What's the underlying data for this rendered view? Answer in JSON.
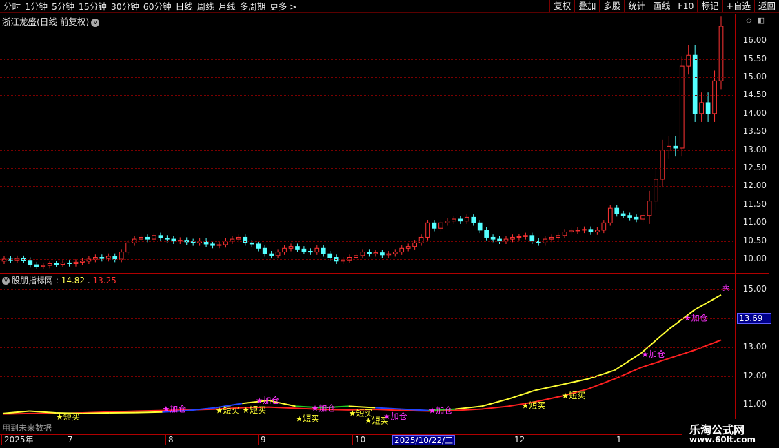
{
  "toolbar": {
    "periods": [
      "分时",
      "1分钟",
      "5分钟",
      "15分钟",
      "30分钟",
      "60分钟",
      "日线",
      "周线",
      "月线",
      "多周期",
      "更多 >"
    ],
    "active_period": "日线",
    "buttons": [
      "复权",
      "叠加",
      "多股",
      "统计",
      "画线",
      "F10",
      "标记",
      "+自选",
      "返回"
    ]
  },
  "price_chart": {
    "title": "浙江龙盛(日线 前复权)",
    "axis_ticks": [
      "16.00",
      "15.50",
      "15.00",
      "14.50",
      "14.00",
      "13.50",
      "13.00",
      "12.50",
      "12.00",
      "11.50",
      "11.00",
      "10.50",
      "10.00"
    ]
  },
  "indicator": {
    "name": "股朋指标网",
    "value1": "14.82",
    "value2": "13.25",
    "cursor_value": "13.69",
    "axis_ticks": [
      "15.00",
      "14.00",
      "13.00",
      "12.00",
      "11.00"
    ],
    "signals": [
      "短买",
      "加仓",
      "卖"
    ],
    "future_note": "用到未来数据"
  },
  "date_axis": {
    "labels": [
      "2025年",
      "7",
      "8",
      "9",
      "10",
      "12",
      "1"
    ],
    "cursor_date": "2025/10/22/三"
  },
  "watermark": {
    "site_name": "乐淘公式网",
    "url": "www.60lt.com"
  },
  "colors": {
    "up": "#ff3333",
    "down": "#54ffff",
    "line_yellow": "#ffff33",
    "line_red": "#ff2020",
    "segment_blue": "#2244ff",
    "segment_green": "#22cc22",
    "signal_buy": "#ffff33",
    "signal_add": "#ff33ff"
  },
  "chart_data": [
    {
      "type": "candlestick",
      "title": "浙江龙盛(日线 前复权)",
      "ylim": [
        9.7,
        16.4
      ],
      "close_series": [
        10.0,
        9.98,
        10.02,
        9.97,
        9.85,
        9.8,
        9.83,
        9.88,
        9.86,
        9.9,
        9.88,
        9.92,
        9.95,
        10.0,
        10.05,
        10.02,
        10.08,
        10.0,
        10.2,
        10.45,
        10.55,
        10.6,
        10.55,
        10.65,
        10.58,
        10.55,
        10.5,
        10.52,
        10.48,
        10.45,
        10.5,
        10.42,
        10.38,
        10.4,
        10.5,
        10.55,
        10.6,
        10.45,
        10.42,
        10.3,
        10.15,
        10.1,
        10.2,
        10.3,
        10.35,
        10.28,
        10.22,
        10.2,
        10.3,
        10.15,
        10.05,
        9.95,
        9.98,
        10.05,
        10.1,
        10.2,
        10.15,
        10.18,
        10.12,
        10.15,
        10.2,
        10.3,
        10.35,
        10.45,
        10.6,
        11.0,
        10.85,
        11.0,
        11.05,
        11.1,
        11.05,
        11.15,
        11.0,
        10.8,
        10.6,
        10.55,
        10.5,
        10.55,
        10.6,
        10.62,
        10.65,
        10.5,
        10.45,
        10.55,
        10.6,
        10.65,
        10.75,
        10.78,
        10.8,
        10.82,
        10.75,
        10.8,
        11.0,
        11.4,
        11.25,
        11.2,
        11.15,
        11.1,
        11.2,
        11.6,
        12.2,
        13.0,
        13.1,
        13.05,
        15.3,
        15.6,
        14.0,
        14.3,
        14.0,
        14.9,
        16.4
      ],
      "date_labels": [
        "2025年",
        "7",
        "8",
        "9",
        "10",
        "12",
        "1"
      ]
    },
    {
      "type": "line",
      "title": "股朋指标网",
      "ylim": [
        10.6,
        15.2
      ],
      "series": [
        {
          "values": [
            10.7,
            10.78,
            10.72,
            10.7,
            10.72,
            10.73,
            10.75,
            10.8,
            10.9,
            11.05,
            11.15,
            10.95,
            10.9,
            10.95,
            10.9,
            10.85,
            10.8,
            10.85,
            10.95,
            11.2,
            11.5,
            11.7,
            11.9,
            12.2,
            12.8,
            13.6,
            14.3,
            14.82
          ]
        },
        {
          "values": [
            10.68,
            10.7,
            10.7,
            10.72,
            10.75,
            10.78,
            10.8,
            10.82,
            10.85,
            10.9,
            10.92,
            10.88,
            10.84,
            10.82,
            10.84,
            10.8,
            10.78,
            10.8,
            10.85,
            10.95,
            11.1,
            11.3,
            11.55,
            11.9,
            12.3,
            12.6,
            12.9,
            13.25
          ]
        }
      ]
    }
  ]
}
